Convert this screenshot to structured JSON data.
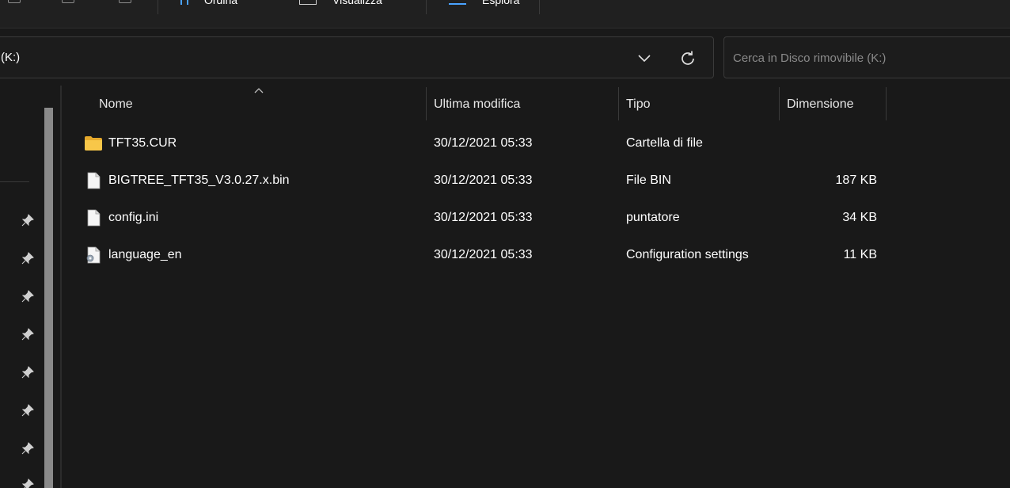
{
  "toolbar": {
    "sort_label": "Ordina",
    "view_label": "Visualizza",
    "explore_label": "Esplora"
  },
  "address": {
    "path_fragment": "(K:)"
  },
  "search": {
    "placeholder": "Cerca in Disco rimovibile (K:)"
  },
  "columns": {
    "name": "Nome",
    "modified": "Ultima modifica",
    "type": "Tipo",
    "size": "Dimensione"
  },
  "files": [
    {
      "name": "TFT35.CUR",
      "modified": "30/12/2021 05:33",
      "type": "Cartella di file",
      "size": "",
      "icon": "folder-icon"
    },
    {
      "name": "BIGTREE_TFT35_V3.0.27.x.bin",
      "modified": "30/12/2021 05:33",
      "type": "File BIN",
      "size": "187 KB",
      "icon": "file-icon"
    },
    {
      "name": "config.ini",
      "modified": "30/12/2021 05:33",
      "type": "puntatore",
      "size": "34 KB",
      "icon": "file-icon"
    },
    {
      "name": "language_en",
      "modified": "30/12/2021 05:33",
      "type": "Configuration settings",
      "size": "11 KB",
      "icon": "settings-file-icon"
    }
  ],
  "colors": {
    "background": "#191919",
    "folder": "#f8c749",
    "text": "#ffffff",
    "muted": "#8a8a8a"
  }
}
